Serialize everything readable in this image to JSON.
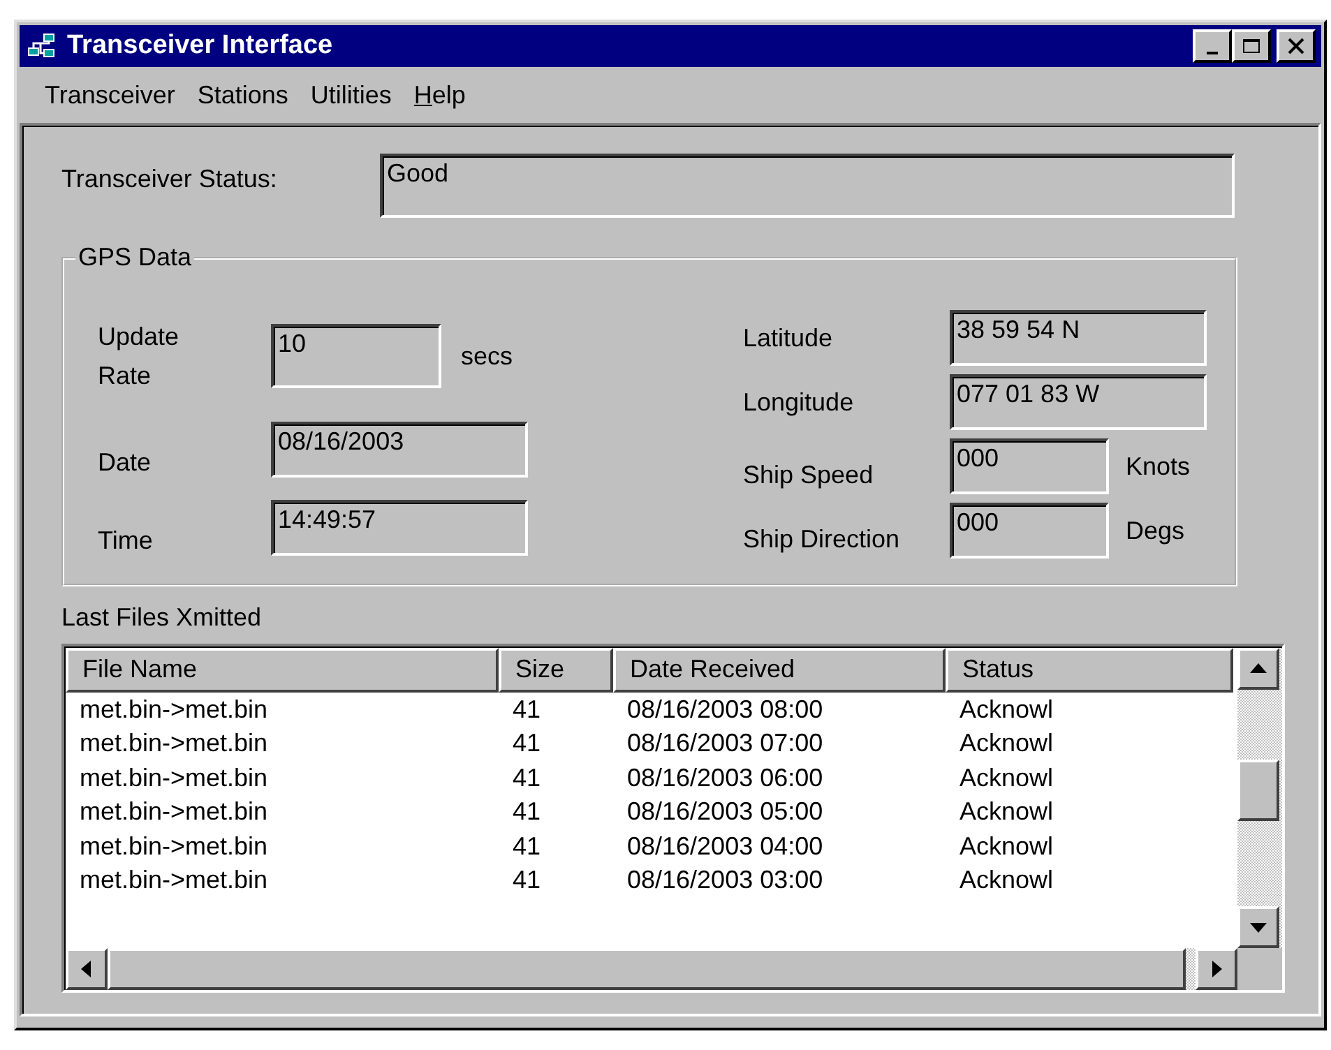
{
  "window": {
    "title": "Transceiver Interface"
  },
  "menu": [
    {
      "label": "Transceiver",
      "mnemonic": false
    },
    {
      "label": "Stations",
      "mnemonic": false
    },
    {
      "label": "Utilities",
      "mnemonic": false
    },
    {
      "label": "Help",
      "mnemonic": true
    }
  ],
  "status": {
    "label": "Transceiver Status:",
    "value": "Good"
  },
  "gps": {
    "title": "GPS Data",
    "left": [
      {
        "label": "Update Rate",
        "value": "10",
        "unit": "secs"
      },
      {
        "label": "Date",
        "value": "08/16/2003"
      },
      {
        "label": "Time",
        "value": "14:49:57"
      }
    ],
    "right": [
      {
        "label": "Latitude",
        "value": "38 59 54 N"
      },
      {
        "label": "Longitude",
        "value": "077 01 83 W"
      },
      {
        "label": "Ship Speed",
        "value": "000",
        "unit": "Knots"
      },
      {
        "label": "Ship Direction",
        "value": "000",
        "unit": "Degs"
      }
    ]
  },
  "files": {
    "label": "Last Files Xmitted",
    "columns": [
      "File Name",
      "Size",
      "Date Received",
      "Status"
    ],
    "rows": [
      [
        "met.bin->met.bin",
        "41",
        "08/16/2003 08:00",
        "Acknowl"
      ],
      [
        "met.bin->met.bin",
        "41",
        "08/16/2003 07:00",
        "Acknowl"
      ],
      [
        "met.bin->met.bin",
        "41",
        "08/16/2003 06:00",
        "Acknowl"
      ],
      [
        "met.bin->met.bin",
        "41",
        "08/16/2003 05:00",
        "Acknowl"
      ],
      [
        "met.bin->met.bin",
        "41",
        "08/16/2003 04:00",
        "Acknowl"
      ],
      [
        "met.bin->met.bin",
        "41",
        "08/16/2003 03:00",
        "Acknowl"
      ]
    ]
  }
}
